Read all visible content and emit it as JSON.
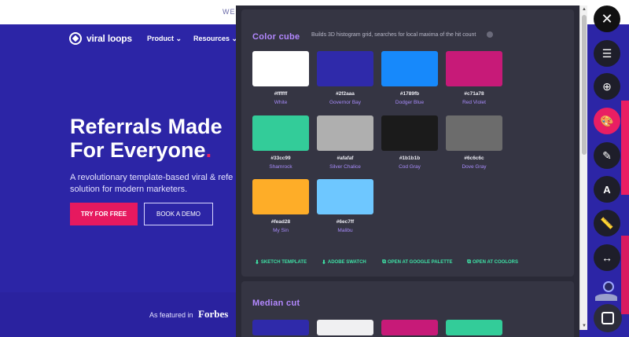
{
  "site": {
    "top_strip": "WE",
    "logo": "viral loops",
    "nav": [
      "Product",
      "Resources"
    ],
    "hero_line1": "Referrals Made",
    "hero_line2": "For Everyone",
    "hero_dot": ".",
    "hero_sub": "A revolutionary template-based viral & refe solution for modern marketers.",
    "btn_try": "TRY FOR FREE",
    "btn_demo": "BOOK A DEMO",
    "featured": "As featured in",
    "forbes": "Forbes"
  },
  "panel": {
    "title": "Color cube",
    "desc": "Builds 3D histogram grid, searches for local maxima of the hit count",
    "swatches": [
      {
        "hex": "#ffffff",
        "name": "White",
        "color": "#ffffff"
      },
      {
        "hex": "#2f2aaa",
        "name": "Governor Bay",
        "color": "#2f2aaa"
      },
      {
        "hex": "#1789fb",
        "name": "Dodger Blue",
        "color": "#1789fb"
      },
      {
        "hex": "#c71a78",
        "name": "Red Violet",
        "color": "#c71a78"
      },
      {
        "hex": "#33cc99",
        "name": "Shamrock",
        "color": "#33cc99"
      },
      {
        "hex": "#afafaf",
        "name": "Silver Chalice",
        "color": "#afafaf"
      },
      {
        "hex": "#1b1b1b",
        "name": "Cod Gray",
        "color": "#1b1b1b"
      },
      {
        "hex": "#6c6c6c",
        "name": "Dove Gray",
        "color": "#6c6c6c"
      },
      {
        "hex": "#fead28",
        "name": "My Sin",
        "color": "#fead28"
      },
      {
        "hex": "#6ec7ff",
        "name": "Malibu",
        "color": "#6ec7ff"
      }
    ],
    "links": [
      "SKETCH TEMPLATE",
      "ADOBE SWATCH",
      "OPEN AT GOOGLE PALETTE",
      "OPEN AT COOLORS"
    ],
    "median_title": "Median cut",
    "median_colors": [
      "#2f2aaa",
      "#f0f0f2",
      "#c71a78",
      "#33cc99"
    ]
  },
  "toolbar": {
    "close": "✕",
    "items": [
      {
        "icon": "sliders-icon",
        "glyph": "☰"
      },
      {
        "icon": "crosshair-icon",
        "glyph": "⊕"
      },
      {
        "icon": "palette-icon",
        "glyph": "🎨",
        "active": true
      },
      {
        "icon": "pen-icon",
        "glyph": "✎"
      },
      {
        "icon": "font-icon",
        "glyph": "A"
      },
      {
        "icon": "ruler-icon",
        "glyph": "📏"
      },
      {
        "icon": "resize-icon",
        "glyph": "↔"
      }
    ]
  }
}
